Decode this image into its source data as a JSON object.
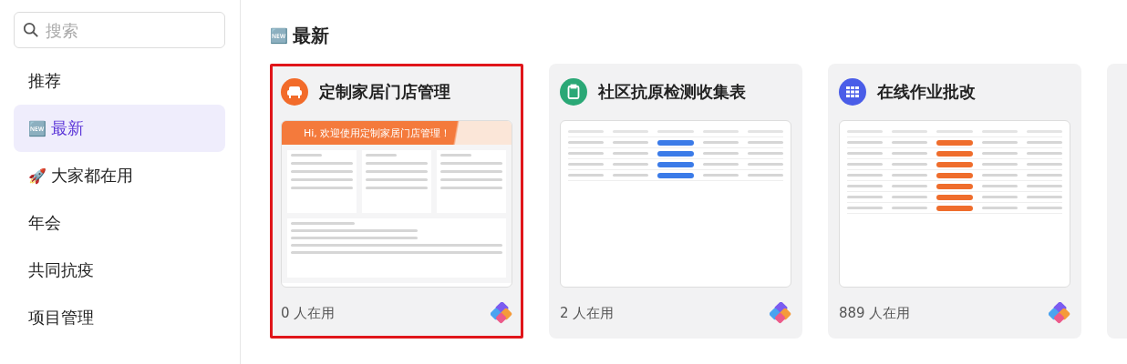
{
  "sidebar": {
    "search": {
      "placeholder": "搜索"
    },
    "items": [
      {
        "label": "推荐",
        "selected": false
      },
      {
        "label": "最新",
        "emoji": "🆕",
        "selected": true
      },
      {
        "label": "大家都在用",
        "emoji": "🚀",
        "selected": false
      },
      {
        "label": "年会",
        "selected": false
      },
      {
        "label": "共同抗疫",
        "selected": false
      },
      {
        "label": "项目管理",
        "selected": false
      }
    ]
  },
  "section": {
    "emoji": "🆕",
    "title": "最新"
  },
  "cards": [
    {
      "title": "定制家居门店管理",
      "kind": "sofa",
      "color": "#f26b2a",
      "preview": {
        "kind": "dashboard",
        "banner": "Hi, 欢迎使用定制家居门店管理！"
      },
      "users": "0 人在用",
      "selected": true
    },
    {
      "title": "社区抗原检测收集表",
      "kind": "clipboard",
      "color": "#2aa876",
      "preview": {
        "kind": "table4"
      },
      "users": "2 人在用",
      "selected": false
    },
    {
      "title": "在线作业批改",
      "kind": "grid",
      "color": "#4a5de8",
      "preview": {
        "kind": "table7"
      },
      "users": "889 人在用",
      "selected": false
    }
  ]
}
